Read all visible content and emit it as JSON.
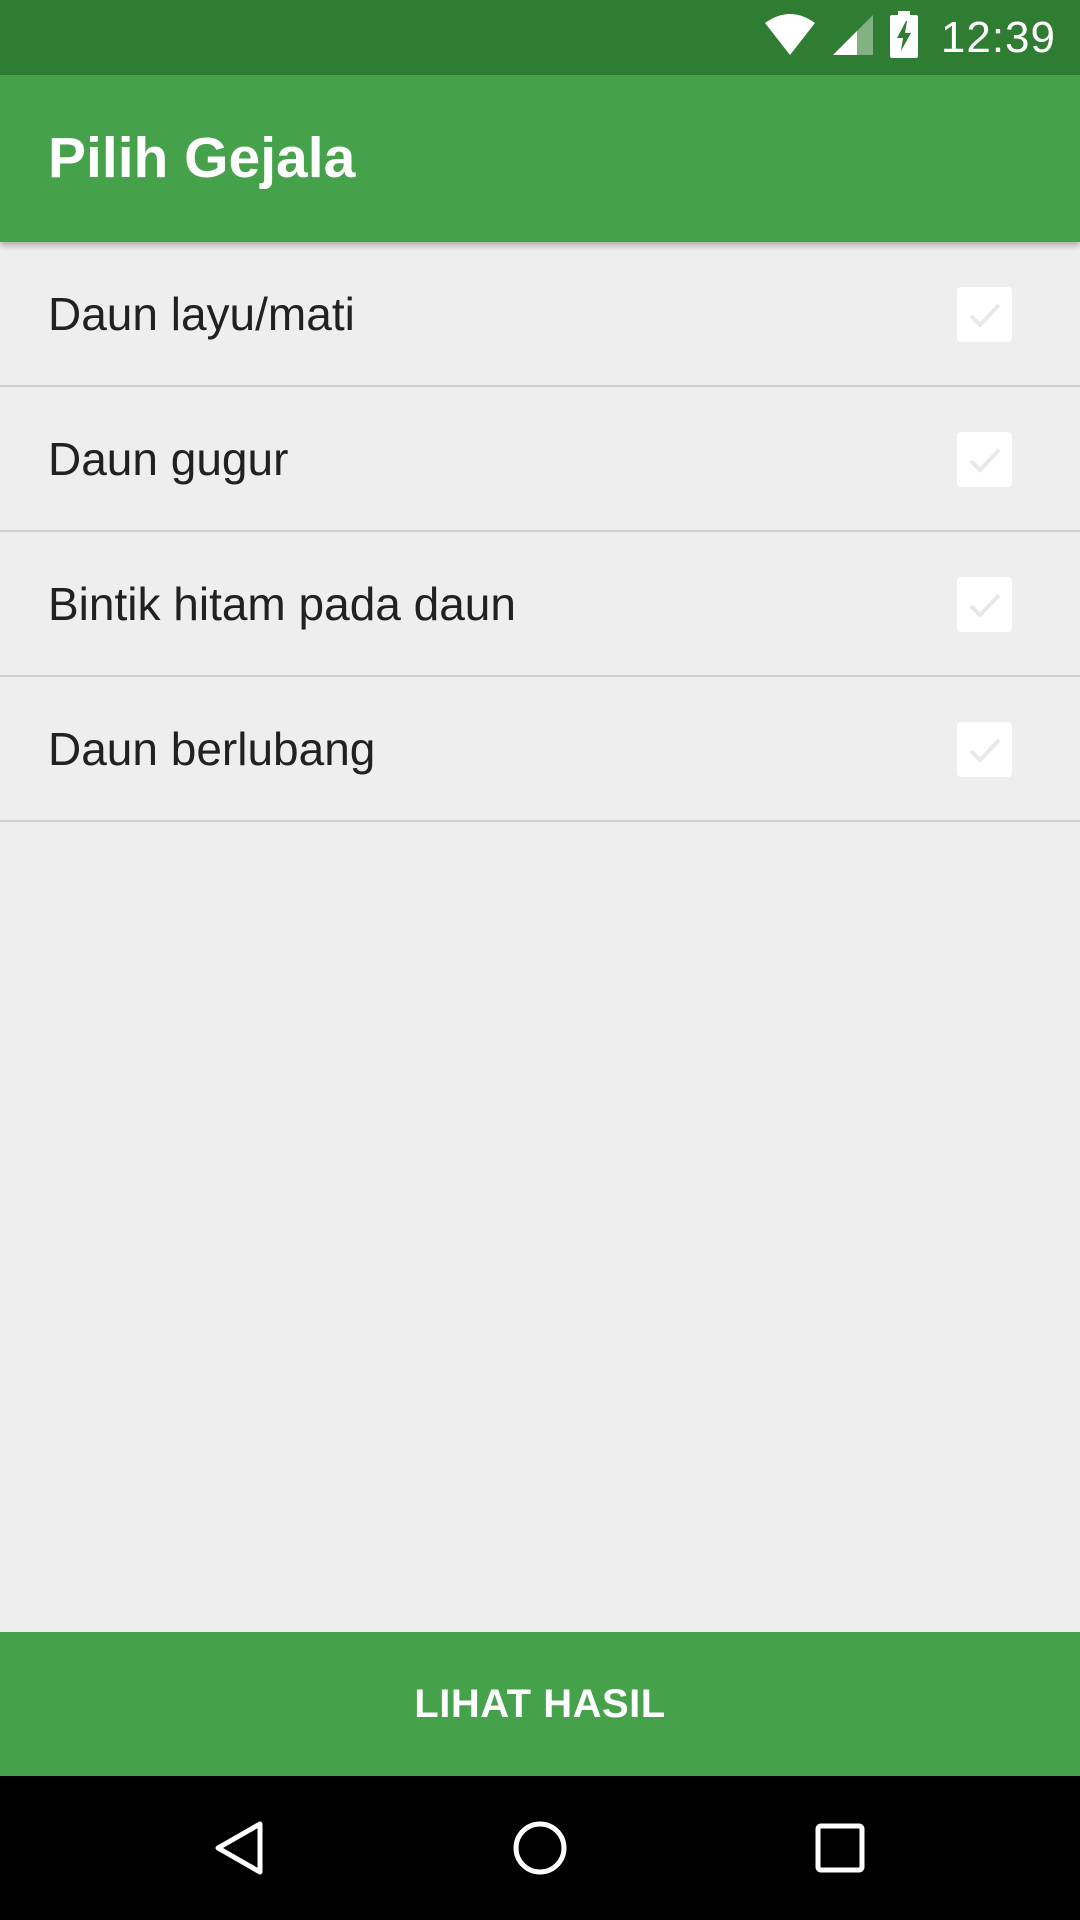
{
  "status_bar": {
    "time": "12:39",
    "icons": [
      "wifi-icon",
      "cellular-signal-icon",
      "battery-charging-icon"
    ]
  },
  "app_bar": {
    "title": "Pilih Gejala"
  },
  "symptoms": [
    {
      "label": "Daun layu/mati",
      "checked": false
    },
    {
      "label": "Daun gugur",
      "checked": false
    },
    {
      "label": "Bintik hitam pada daun",
      "checked": false
    },
    {
      "label": "Daun berlubang",
      "checked": false
    }
  ],
  "action_button": {
    "label": "LIHAT HASIL"
  },
  "nav_bar": {
    "icons": [
      "back-icon",
      "home-icon",
      "recents-icon"
    ]
  },
  "colors": {
    "primary": "#46a24a",
    "primary_dark": "#2f7d32",
    "background": "#eeeeee",
    "text": "#212121",
    "divider": "#cfcfcf"
  }
}
